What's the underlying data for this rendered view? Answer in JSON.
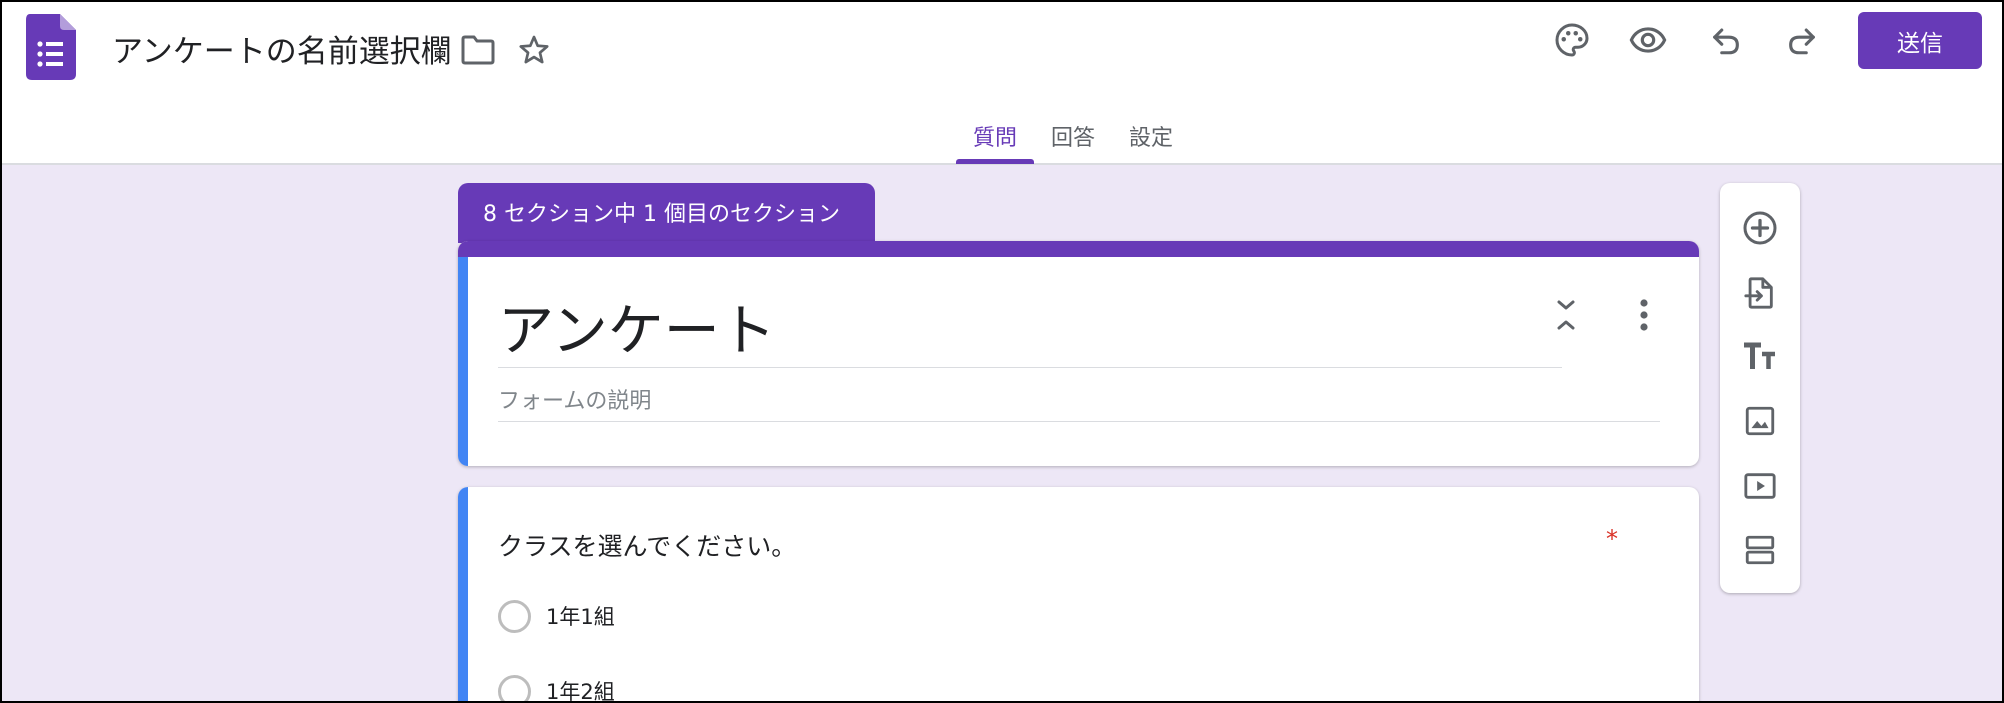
{
  "header": {
    "doc_title": "アンケートの名前選択欄",
    "send_label": "送信",
    "brand_color": "#673ab7"
  },
  "tabs": [
    {
      "label": "質問",
      "active": true
    },
    {
      "label": "回答",
      "active": false
    },
    {
      "label": "設定",
      "active": false
    }
  ],
  "section": {
    "tag_label": "8 セクション中 1 個目のセクション"
  },
  "form": {
    "title": "アンケート",
    "description_placeholder": "フォームの説明"
  },
  "question": {
    "text": "クラスを選んでください。",
    "required_mark": "*",
    "options": [
      "1年1組",
      "1年2組"
    ]
  },
  "icons": {
    "header": [
      "forms-logo-icon",
      "folder-icon",
      "star-icon",
      "palette-icon",
      "eye-icon",
      "undo-icon",
      "redo-icon"
    ],
    "card": [
      "collapse-icon",
      "more-vert-icon"
    ],
    "toolbar": [
      "add-circle-icon",
      "import-icon",
      "text-title-icon",
      "image-icon",
      "video-icon",
      "section-icon"
    ]
  },
  "colors": {
    "accent": "#673ab7",
    "background": "#ede7f6",
    "card_left_bar": "#4285f4",
    "required": "#d93025"
  }
}
